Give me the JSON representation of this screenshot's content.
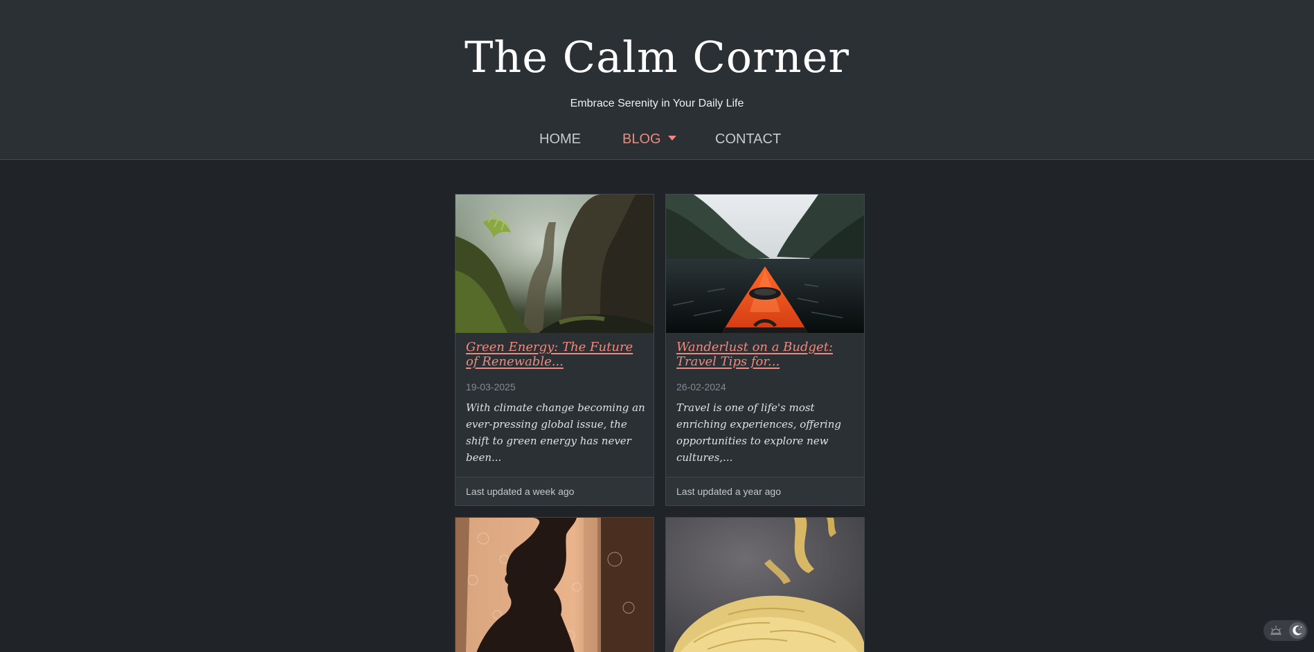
{
  "site": {
    "title": "The Calm Corner",
    "tagline": "Embrace Serenity in Your Daily Life"
  },
  "nav": {
    "items": [
      {
        "label": "HOME",
        "active": false
      },
      {
        "label": "BLOG",
        "active": true,
        "has_dropdown": true
      },
      {
        "label": "CONTACT",
        "active": false
      }
    ]
  },
  "posts": [
    {
      "title": "Green Energy: The Future of Renewable...",
      "date": "19-03-2025",
      "excerpt": "With climate change becoming an ever-pressing global issue, the shift to green energy has never been...",
      "updated": "Last updated a week ago",
      "image_icon": "forest-image"
    },
    {
      "title": "Wanderlust on a Budget: Travel Tips for...",
      "date": "26-02-2024",
      "excerpt": "Travel is one of life's most enriching experiences, offering opportunities to explore new cultures,...",
      "updated": "Last updated a year ago",
      "image_icon": "kayak-image"
    },
    {
      "image_icon": "silhouette-image"
    },
    {
      "image_icon": "pasta-image"
    }
  ],
  "theme_toggle": {
    "icons": [
      "sun-icon",
      "moon-icon"
    ],
    "mode": "dark"
  },
  "colors": {
    "background": "#202328",
    "header_background": "#2b3035",
    "accent": "#ee8b7e",
    "card_background": "#2b3035"
  }
}
